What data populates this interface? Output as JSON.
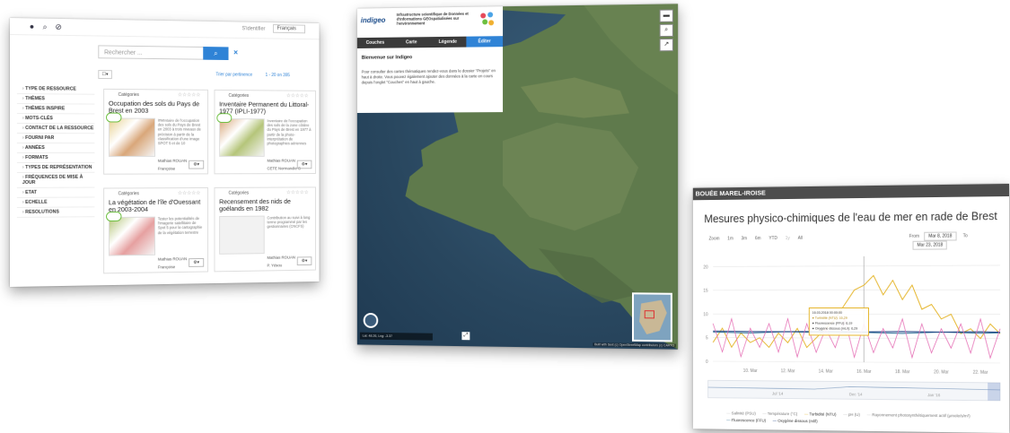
{
  "catalogue": {
    "search_placeholder": "Rechercher ...",
    "search_btn_icon": "search-icon",
    "subscribe": "S'identifier",
    "language": "Français",
    "sort": "Trier par pertinence",
    "pagination": "1 - 20 on 395",
    "facets": [
      "Type de ressource",
      "Thèmes",
      "Thèmes INSPIRE",
      "Mots-clés",
      "Contact de la ressource",
      "Fourni par",
      "Années",
      "Formats",
      "Types de représentation",
      "Fréquences de mise à jour",
      "Etat",
      "Echelle",
      "Resolutions"
    ],
    "cards": [
      {
        "category": "Catégories",
        "stars": "☆☆☆☆☆",
        "title": "Occupation des sols du Pays de Brest en 2003",
        "desc": "Inventaire de l'occupation des sols du Pays de Brest en 2003 à trois niveaux de précision à partir de la classification d'une image SPOT 5 et de 10",
        "author": "Mathias ROUAN",
        "author2": "Françoise",
        "badge": "download"
      },
      {
        "category": "Catégories",
        "stars": "☆☆☆☆☆",
        "title": "Inventaire Permanent du Littoral-1977 (IPLI-1977)",
        "desc": "Inventaire de l'occupation des sols de la zone côtière du Pays de Brest en 1977 à partir de la photo-interprétation de photographies aériennes",
        "author": "Mathias ROUAN",
        "author2": "CETE Normandie C",
        "badge": "download"
      },
      {
        "category": "Catégories",
        "stars": "☆☆☆☆☆",
        "title": "La végétation de l'île d'Ouessant en 2003-2004",
        "desc": "Tester les potentialités de l'imagerie satellitaire de Spot 5 pour la cartographie de la végétation terrestre",
        "author": "Mathias ROUAN",
        "author2": "Françoise",
        "badge": "download"
      },
      {
        "category": "Catégories",
        "stars": "☆☆☆☆☆",
        "title": "Recensement des nids de goélands en 1982",
        "desc": "Contribution au suivi à long terme programmé par les gestionnaires (CNCFS)",
        "author": "Mathias ROUAN",
        "author2": "P. Yésou",
        "badge": ""
      }
    ]
  },
  "mapviewer": {
    "logo": "indigeo",
    "infra_title": "Infrastructure scientifique de Données et d'Informations GEOspatialisées sur l'environnement",
    "tabs": [
      "Couches",
      "Carte",
      "Légende",
      "Éditer"
    ],
    "welcome_title": "Bienvenue sur Indigeo",
    "welcome_text": "Pour consulter des cartes thématiques rendez-vous dans le dossier \"Projets\" en haut à droite. Vous pouvez également ajouter des données à la carte en cours depuis l'onglet \"Couches\" en haut à gauche.",
    "coords": "Lat: 48.26, Lng: -3.37",
    "attribution": "Built with Sext (c) OpenStreetMap contributors (c) CARTO"
  },
  "chartpanel": {
    "header": "BOUÉE MAREL-IROISE",
    "zoom_label": "Zoom",
    "zoom_options": [
      "1m",
      "3m",
      "6m",
      "YTD",
      "1y",
      "All"
    ],
    "from_label": "From",
    "from_value": "Mar 8, 2018",
    "to_label": "To",
    "to_value": "Mar 23, 2018",
    "tooltip": [
      "16.03.2018 00:00:00",
      "● Turbidité (NTU): 16,29",
      "● Fluorescence (FFU): 6,19",
      "● Oxygène dissous (mL/l): 6,29"
    ],
    "legend": [
      {
        "label": "Salinité (PSU)",
        "on": false,
        "color": "#c8c8c8"
      },
      {
        "label": "Température (°C)",
        "on": false,
        "color": "#c8c8c8"
      },
      {
        "label": "Turbidité (NTU)",
        "on": true,
        "color": "#e5b52a"
      },
      {
        "label": "pH (U)",
        "on": false,
        "color": "#c8c8c8"
      },
      {
        "label": "Rayonnement photosynthétiquement actif (µmole/s/m²)",
        "on": false,
        "color": "#c8c8c8"
      },
      {
        "label": "Fluorescence (FFU)",
        "on": true,
        "color": "#2c6e96"
      },
      {
        "label": "Oxygène dissous (ml/l)",
        "on": true,
        "color": "#1c3f80"
      }
    ]
  },
  "chart_data": {
    "type": "line",
    "title": "Mesures physico-chimiques de l'eau de mer en rade de Brest",
    "xlabel": "",
    "ylabel": "",
    "x_ticks": [
      "10. Mar",
      "12. Mar",
      "14. Mar",
      "16. Mar",
      "18. Mar",
      "20. Mar",
      "22. Mar"
    ],
    "y_ticks": [
      0,
      5,
      10,
      15,
      20
    ],
    "ylim": [
      0,
      22
    ],
    "navigator_ticks": [
      "Jul '14",
      "Dec '14",
      "Jan '16"
    ],
    "series": [
      {
        "name": "Turbidité (NTU)",
        "color": "#e5b52a",
        "x": [
          8,
          8.5,
          9,
          9.5,
          10,
          10.5,
          11,
          11.5,
          12,
          12.5,
          13,
          13.5,
          14,
          14.5,
          15,
          15.5,
          16,
          16.5,
          17,
          17.5,
          18,
          18.5,
          19,
          19.5,
          20,
          20.5,
          21,
          21.5,
          22,
          22.5,
          23
        ],
        "values": [
          4,
          7,
          3,
          6,
          4,
          5,
          3,
          6,
          4,
          7,
          3,
          5,
          7,
          9,
          12,
          15,
          16,
          18,
          14,
          17,
          13,
          16,
          11,
          12,
          9,
          10,
          6,
          7,
          5,
          8,
          6
        ]
      },
      {
        "name": "Fluorescence (FFU)",
        "color": "#2c6e96",
        "x": [
          8,
          10,
          12,
          14,
          16,
          18,
          20,
          22,
          23
        ],
        "values": [
          6.2,
          6.0,
          6.3,
          6.1,
          6.2,
          6.0,
          6.3,
          6.1,
          6.2
        ]
      },
      {
        "name": "Oxygène dissous (ml/l)",
        "color": "#1c3f80",
        "x": [
          8,
          10,
          12,
          14,
          16,
          18,
          20,
          22,
          23
        ],
        "values": [
          6.4,
          6.3,
          6.3,
          6.4,
          6.3,
          6.4,
          6.3,
          6.4,
          6.3
        ]
      },
      {
        "name": "Rayonnement photosynthétiquement actif",
        "color": "#e56fb5",
        "x": [
          8,
          8.5,
          9,
          9.5,
          10,
          10.5,
          11,
          11.5,
          12,
          12.5,
          13,
          13.5,
          14,
          14.5,
          15,
          15.5,
          16,
          16.5,
          17,
          17.5,
          18,
          18.5,
          19,
          19.5,
          20,
          20.5,
          21,
          21.5,
          22,
          22.5,
          23
        ],
        "values": [
          8,
          2,
          9,
          1,
          7,
          3,
          8,
          2,
          9,
          1,
          8,
          2,
          7,
          3,
          9,
          1,
          8,
          2,
          7,
          3,
          9,
          1,
          8,
          2,
          7,
          3,
          8,
          2,
          9,
          1,
          7
        ]
      }
    ]
  }
}
